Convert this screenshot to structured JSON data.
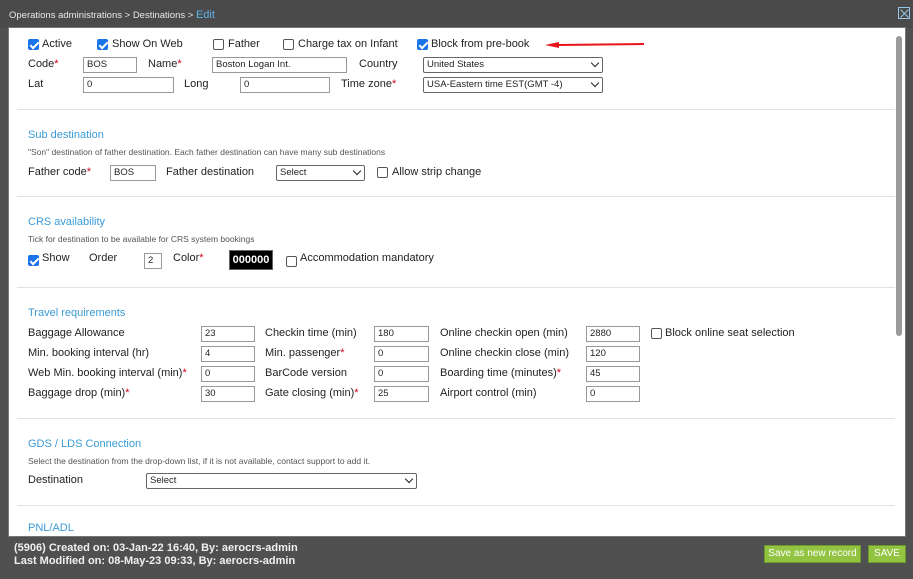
{
  "breadcrumb": {
    "path": "Operations administrations > Destinations > ",
    "current": "Edit"
  },
  "general": {
    "active": {
      "label": "Active",
      "checked": true
    },
    "show_on_web": {
      "label": "Show On Web",
      "checked": true
    },
    "father": {
      "label": "Father",
      "checked": false
    },
    "charge_tax_infant": {
      "label": "Charge tax on Infant",
      "checked": false
    },
    "block_prebook": {
      "label": "Block from pre-book",
      "checked": true
    },
    "code_label": "Code",
    "code_value": "BOS",
    "name_label": "Name",
    "name_value": "Boston Logan Int.",
    "country_label": "Country",
    "country_value": "United States",
    "lat_label": "Lat",
    "lat_value": "0",
    "long_label": "Long",
    "long_value": "0",
    "timezone_label": "Time zone",
    "timezone_value": "USA-Eastern time EST(GMT -4)"
  },
  "sub_destination": {
    "title": "Sub destination",
    "desc": "\"Son\" destination of father destination. Each father destination can have many sub destinations",
    "father_code_label": "Father code",
    "father_code_value": "BOS",
    "father_dest_label": "Father destination",
    "father_dest_value": "Select",
    "allow_strip_label": "Allow strip change"
  },
  "crs": {
    "title": "CRS availability",
    "desc": "Tick for destination to be available for CRS system bookings",
    "show_label": "Show",
    "order_label": "Order",
    "order_value": "2",
    "color_label": "Color",
    "color_value": "000000",
    "accommodation_label": "Accommodation mandatory"
  },
  "travel": {
    "title": "Travel requirements",
    "baggage_allowance_label": "Baggage Allowance",
    "baggage_allowance_value": "23",
    "min_booking_label": "Min. booking interval (hr)",
    "min_booking_value": "4",
    "web_min_booking_label": "Web Min. booking interval (min)",
    "web_min_booking_value": "0",
    "baggage_drop_label": "Baggage drop (min)",
    "baggage_drop_value": "30",
    "checkin_time_label": "Checkin time (min)",
    "checkin_time_value": "180",
    "min_passenger_label": "Min. passenger",
    "min_passenger_value": "0",
    "barcode_label": "BarCode version",
    "barcode_value": "0",
    "gate_closing_label": "Gate closing (min)",
    "gate_closing_value": "25",
    "online_open_label": "Online checkin open (min)",
    "online_open_value": "2880",
    "online_close_label": "Online checkin close (min)",
    "online_close_value": "120",
    "boarding_label": "Boarding time (minutes)",
    "boarding_value": "45",
    "airport_control_label": "Airport control (min)",
    "airport_control_value": "0",
    "block_seat_label": "Block online seat selection"
  },
  "gds": {
    "title": "GDS / LDS Connection",
    "desc": "Select the destination from the drop-down list, if it is not available, contact support to add it.",
    "destination_label": "Destination",
    "destination_value": "Select",
    "next_section_partial": "PNL/ADL"
  },
  "footer": {
    "created": "(5906) Created on: 03-Jan-22 16:40, By: aerocrs-admin",
    "modified": "Last Modified on: 08-May-23 09:33, By: aerocrs-admin",
    "save_new_label": "Save as new record",
    "save_label": "SAVE"
  },
  "colors": {
    "accent": "#3a9bd5",
    "required": "#d0021b",
    "button": "#92c441",
    "annotation_arrow": "#e8141c"
  }
}
